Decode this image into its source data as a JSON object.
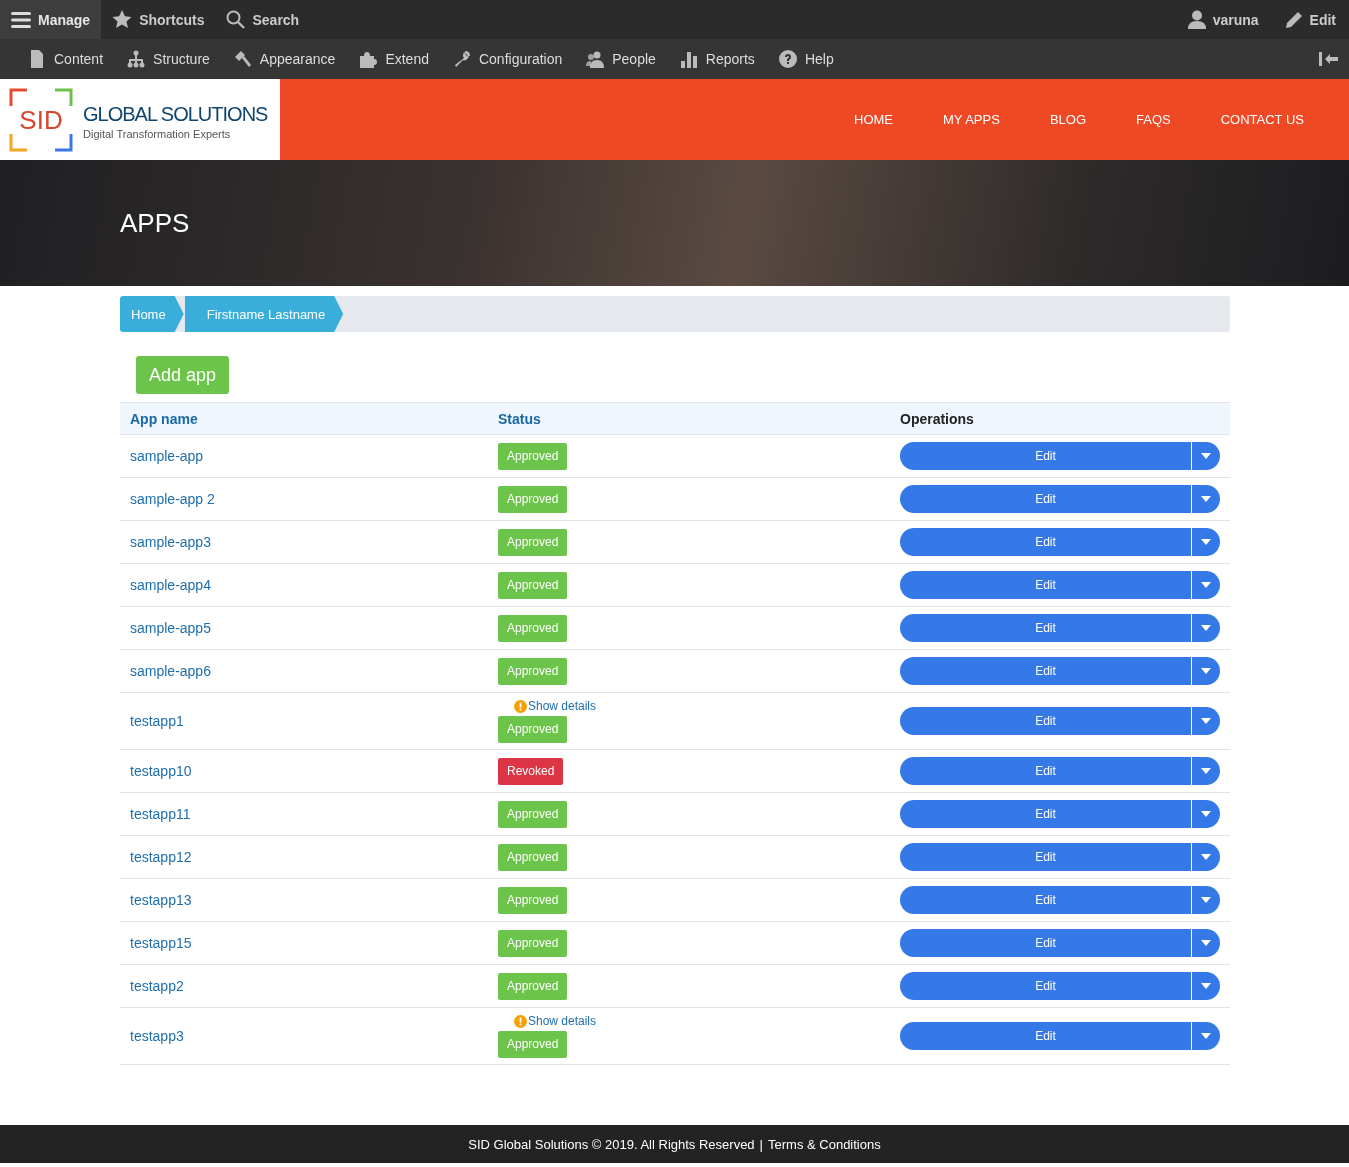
{
  "toolbar": {
    "left": [
      {
        "label": "Manage",
        "selected": true
      },
      {
        "label": "Shortcuts",
        "selected": false
      },
      {
        "label": "Search",
        "selected": false
      }
    ],
    "right": [
      {
        "label": "varuna"
      },
      {
        "label": "Edit"
      }
    ]
  },
  "admin_menu": [
    {
      "label": "Content"
    },
    {
      "label": "Structure"
    },
    {
      "label": "Appearance"
    },
    {
      "label": "Extend"
    },
    {
      "label": "Configuration"
    },
    {
      "label": "People"
    },
    {
      "label": "Reports"
    },
    {
      "label": "Help"
    }
  ],
  "header": {
    "logo_mark": "SID",
    "logo_title": "GLOBAL SOLUTIONS",
    "logo_tagline": "Digital Transformation Experts",
    "nav": [
      "HOME",
      "MY APPS",
      "BLOG",
      "FAQS",
      "CONTACT US"
    ]
  },
  "hero": {
    "title": "APPS"
  },
  "breadcrumb": [
    "Home",
    "Firstname Lastname"
  ],
  "add_button": "Add app",
  "table": {
    "columns": [
      "App name",
      "Status",
      "Operations"
    ],
    "rows": [
      {
        "name": "sample-app",
        "status": "Approved",
        "kind": "approved",
        "action": "Edit"
      },
      {
        "name": "sample-app 2",
        "status": "Approved",
        "kind": "approved",
        "action": "Edit"
      },
      {
        "name": "sample-app3",
        "status": "Approved",
        "kind": "approved",
        "action": "Edit"
      },
      {
        "name": "sample-app4",
        "status": "Approved",
        "kind": "approved",
        "action": "Edit"
      },
      {
        "name": "sample-app5",
        "status": "Approved",
        "kind": "approved",
        "action": "Edit"
      },
      {
        "name": "sample-app6",
        "status": "Approved",
        "kind": "approved",
        "action": "Edit"
      },
      {
        "name": "testapp1",
        "details": "Show details",
        "status": "Approved",
        "kind": "approved",
        "action": "Edit"
      },
      {
        "name": "testapp10",
        "status": "Revoked",
        "kind": "revoked",
        "action": "Edit"
      },
      {
        "name": "testapp11",
        "status": "Approved",
        "kind": "approved",
        "action": "Edit"
      },
      {
        "name": "testapp12",
        "status": "Approved",
        "kind": "approved",
        "action": "Edit"
      },
      {
        "name": "testapp13",
        "status": "Approved",
        "kind": "approved",
        "action": "Edit"
      },
      {
        "name": "testapp15",
        "status": "Approved",
        "kind": "approved",
        "action": "Edit"
      },
      {
        "name": "testapp2",
        "status": "Approved",
        "kind": "approved",
        "action": "Edit"
      },
      {
        "name": "testapp3",
        "details": "Show details",
        "status": "Approved",
        "kind": "approved",
        "action": "Edit"
      }
    ]
  },
  "footer": {
    "copyright": "SID Global Solutions © 2019. All Rights Reserved",
    "separator": "|",
    "link": "Terms & Conditions"
  }
}
